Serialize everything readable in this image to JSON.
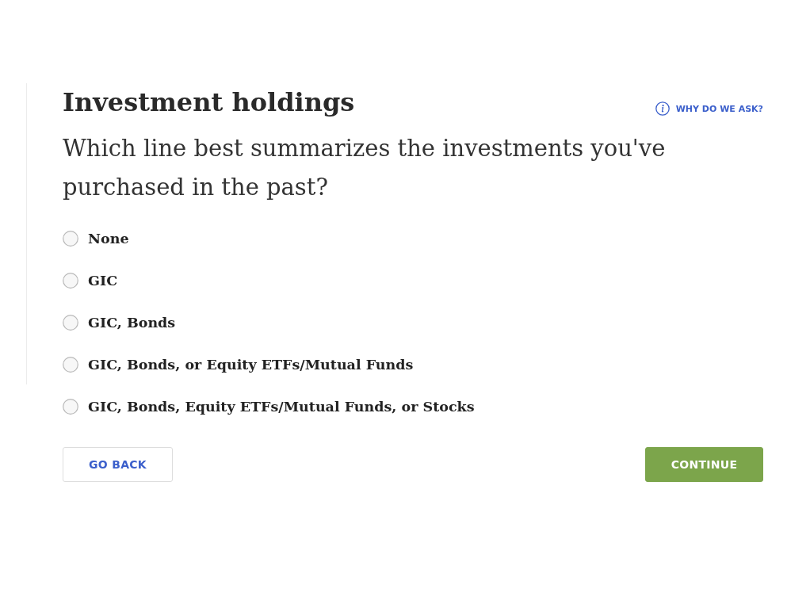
{
  "header": {
    "title": "Investment holdings",
    "help_link": "WHY DO WE ASK?"
  },
  "question": "Which line best summarizes the investments you've purchased in the past?",
  "options": [
    {
      "label": "None",
      "selected": false
    },
    {
      "label": "GIC",
      "selected": false
    },
    {
      "label": "GIC, Bonds",
      "selected": false
    },
    {
      "label": "GIC, Bonds, or Equity ETFs/Mutual Funds",
      "selected": false
    },
    {
      "label": "GIC, Bonds, Equity ETFs/Mutual Funds, or Stocks",
      "selected": false
    }
  ],
  "buttons": [
    {
      "label": "GO BACK",
      "kind": "secondary"
    },
    {
      "label": "CONTINUE",
      "kind": "primary"
    }
  ]
}
